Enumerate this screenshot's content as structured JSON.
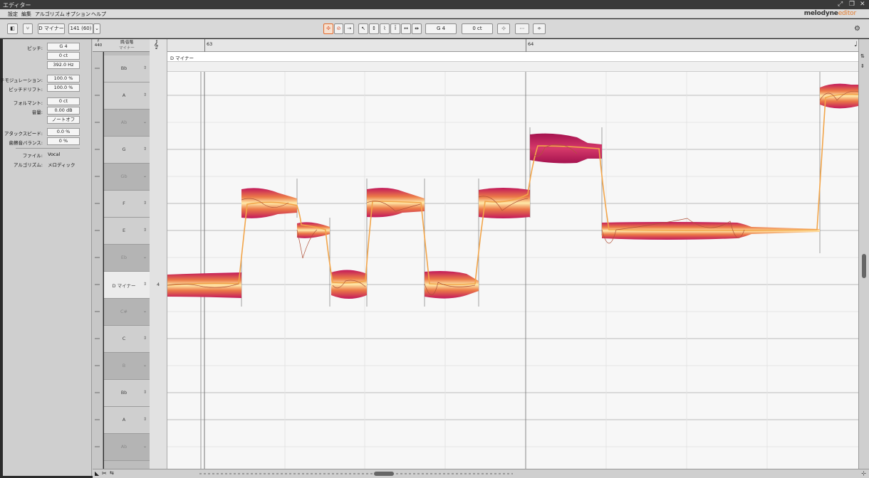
{
  "window": {
    "title": "エディター"
  },
  "menu": {
    "items": [
      "設定",
      "編集",
      "アルゴリズム",
      "オプション",
      "ヘルプ"
    ],
    "logo_main": "melodyne",
    "logo_sub": "editor"
  },
  "toolbar": {
    "scale_label": "D マイナー",
    "tempo_label": "141 (60)",
    "pitch_value": "G 4",
    "cents_value": "0 ct"
  },
  "inspector": {
    "pitch_label": "ピッチ:",
    "pitch_value": "G 4",
    "cents_value": "0 ct",
    "hz_value": "392.0 Hz",
    "modulation_label": "ピッチモジュレーション:",
    "modulation_value": "100.0 %",
    "drift_label": "ピッチドリフト:",
    "drift_value": "100.0 %",
    "formant_label": "フォルマント:",
    "formant_value": "0 ct",
    "volume_label": "音量:",
    "volume_value": "0.00 dB",
    "note_off_label": "ノートオフ",
    "attack_label": "アタックスピード:",
    "attack_value": "0.0 %",
    "sibilant_label": "歯擦音バランス:",
    "sibilant_value": "0 %",
    "file_label": "ファイル:",
    "file_value": "Vocal",
    "algorithm_label": "アルゴリズム:",
    "algorithm_value": "メロディック"
  },
  "ruler": {
    "ref_top": "f",
    "ref_value": "440",
    "scale_top": "調/音階",
    "scale_sub": "マイナー",
    "octave_number": "4",
    "bar_63": "63",
    "bar_64": "64",
    "scale_strip": "D マイナー"
  },
  "keys": [
    {
      "name": "Bb",
      "type": "white",
      "dd": "⇕"
    },
    {
      "name": "A",
      "type": "white",
      "dd": "⇕"
    },
    {
      "name": "Ab",
      "type": "dark",
      "dd": "⌄"
    },
    {
      "name": "G",
      "type": "white",
      "dd": "⇕"
    },
    {
      "name": "Gb",
      "type": "dark",
      "dd": "⌄"
    },
    {
      "name": "F",
      "type": "white",
      "dd": "⇕"
    },
    {
      "name": "E",
      "type": "white",
      "dd": "⇕"
    },
    {
      "name": "Eb",
      "type": "dark",
      "dd": "⌄"
    },
    {
      "name": "D マイナー",
      "type": "sel",
      "dd": "⇕"
    },
    {
      "name": "C#",
      "type": "dark",
      "dd": "⌄"
    },
    {
      "name": "C",
      "type": "white",
      "dd": "⇕"
    },
    {
      "name": "B",
      "type": "dark",
      "dd": "⌄"
    },
    {
      "name": "Bb",
      "type": "white",
      "dd": "⇕"
    },
    {
      "name": "A",
      "type": "white",
      "dd": "⇕"
    },
    {
      "name": "Ab",
      "type": "dark",
      "dd": "⌄"
    }
  ],
  "colors": {
    "blob_dark": "#c2185b",
    "blob_mid": "#e8734a",
    "blob_light": "#ffe7a6",
    "pitch_line": "#f2a54a"
  }
}
